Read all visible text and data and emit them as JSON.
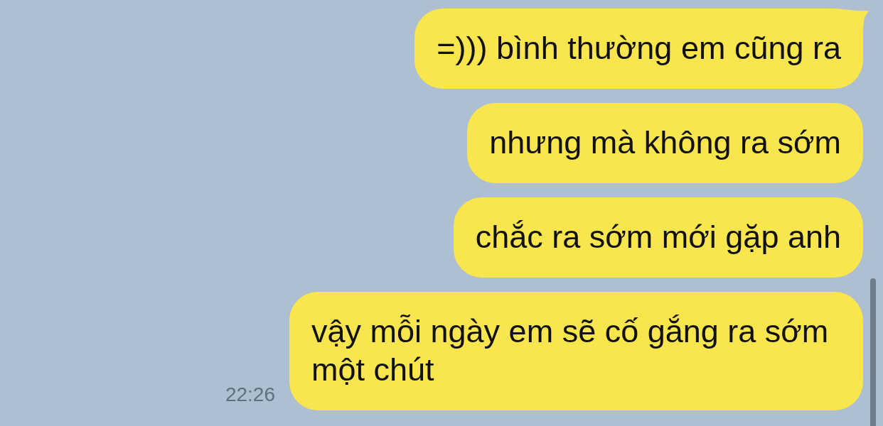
{
  "messages": [
    {
      "text": "=))) bình thường em cũng ra",
      "tail": true
    },
    {
      "text": "nhưng mà không ra sớm",
      "tail": false
    },
    {
      "text": "chắc ra sớm mới gặp anh",
      "tail": false
    },
    {
      "text": "vậy mỗi ngày em sẽ cố gắng ra sớm một chút",
      "tail": false,
      "time": "22:26"
    }
  ]
}
